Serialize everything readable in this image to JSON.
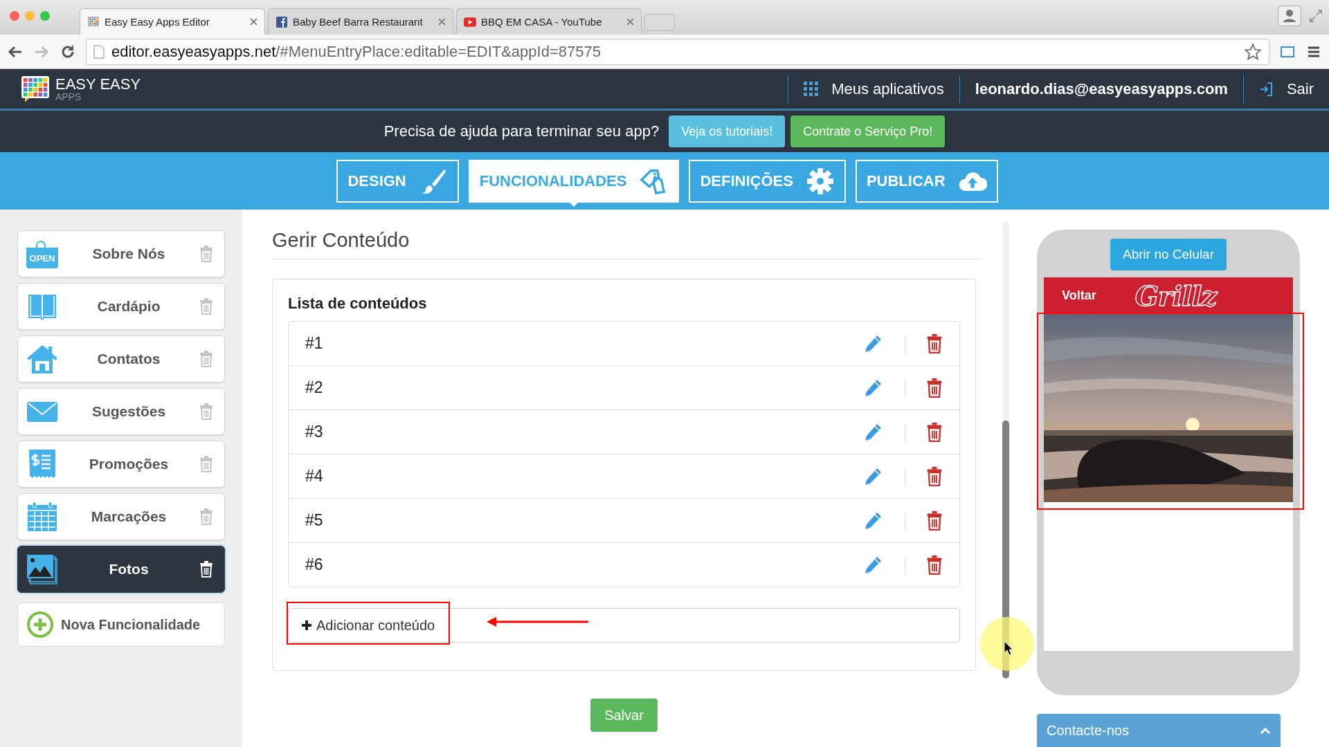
{
  "browser": {
    "tabs": [
      {
        "title": "Easy Easy Apps Editor",
        "kind": "grid",
        "selected": true
      },
      {
        "title": "Baby Beef Barra Restaurant",
        "kind": "facebook",
        "selected": false
      },
      {
        "title": "BBQ EM CASA - YouTube",
        "kind": "video",
        "selected": false
      }
    ],
    "url": {
      "host": "editor.easyeasyapps.net",
      "path": "/#MenuEntryPlace:editable=EDIT&appId=87575"
    }
  },
  "header": {
    "logo": {
      "name": "EASY EASY",
      "sub": "APPS"
    },
    "apps_link": "Meus aplicativos",
    "email": "leonardo.dias@easyeasyapps.com",
    "logout": "Sair"
  },
  "help_bar": {
    "text": "Precisa de ajuda para terminar seu app?",
    "buttons": [
      {
        "label": "Veja os tutoriais!",
        "kind": "info"
      },
      {
        "label": "Contrate o Serviço Pro!",
        "kind": "success"
      }
    ]
  },
  "nav_tabs": [
    {
      "label": "DESIGN",
      "kind": "brush",
      "selected": false
    },
    {
      "label": "FUNCIONALIDADES",
      "kind": "tags",
      "selected": true
    },
    {
      "label": "DEFINIÇÕES",
      "kind": "gear",
      "selected": false
    },
    {
      "label": "PUBLICAR",
      "kind": "cloud",
      "selected": false
    }
  ],
  "sidebar": {
    "items": [
      {
        "label": "Sobre Nós",
        "kind": "sign",
        "icon_text": "OPEN",
        "selected": false
      },
      {
        "label": "Cardápio",
        "kind": "book",
        "selected": false
      },
      {
        "label": "Contatos",
        "kind": "house",
        "selected": false
      },
      {
        "label": "Sugestões",
        "kind": "envelope",
        "selected": false
      },
      {
        "label": "Promoções",
        "kind": "receipt",
        "selected": false
      },
      {
        "label": "Marcações",
        "kind": "calendar",
        "selected": false
      },
      {
        "label": "Fotos",
        "kind": "photos",
        "selected": true
      }
    ],
    "add_button": "Nova Funcionalidade"
  },
  "main": {
    "title": "Gerir Conteúdo",
    "list_title": "Lista de conteúdos",
    "rows": [
      "#1",
      "#2",
      "#3",
      "#4",
      "#5",
      "#6"
    ],
    "add_button": "Adicionar conteúdo",
    "save_button": "Salvar"
  },
  "preview": {
    "open_button": "Abrir no Celular",
    "back": "Voltar",
    "logo": "Grillz"
  },
  "contact_bar": {
    "label": "Contacte-nos"
  }
}
